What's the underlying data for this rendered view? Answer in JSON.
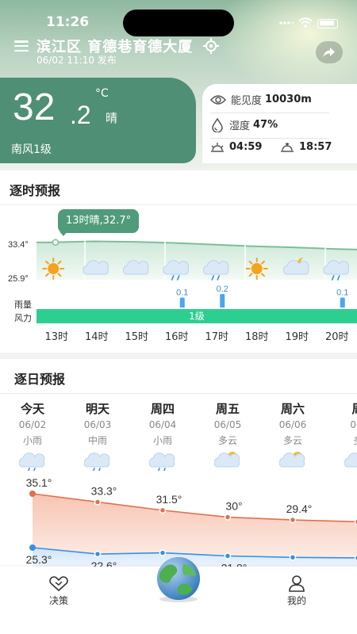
{
  "status_bar": {
    "time": "11:26"
  },
  "header": {
    "location": "滨江区 育德巷育德大厦",
    "publish_time": "06/02 11:10 发布"
  },
  "current": {
    "temp_int": "32",
    "temp_dec": ".2",
    "unit": "°C",
    "desc": "晴",
    "wind": "南风1级",
    "visibility_label": "能见度",
    "visibility_value": "10030m",
    "humidity_label": "湿度",
    "humidity_value": "47%",
    "sunrise": "04:59",
    "sunset": "18:57"
  },
  "hourly": {
    "title": "逐时预报",
    "tooltip": "13时晴,32.7°",
    "y_top": "33.4°",
    "y_bottom": "25.9°",
    "rain_label": "雨量",
    "wind_label": "风力",
    "wind_value": "1级",
    "hours": [
      "13时",
      "14时",
      "15时",
      "16时",
      "17时",
      "18时",
      "19时",
      "20时"
    ],
    "icons": [
      "sun-icon",
      "cloud-icon",
      "cloud-icon",
      "cloud-rain-icon",
      "cloud-rain-icon",
      "sun-icon",
      "cloud-moon-icon",
      "cloud-rain-icon"
    ],
    "rain_labels": [
      "",
      "",
      "",
      "0.1",
      "0.2",
      "",
      "",
      "0.1"
    ],
    "rain_values": [
      0,
      0,
      0,
      0.1,
      0.2,
      0,
      0,
      0.1
    ],
    "temps": [
      32.7,
      32.9,
      32.8,
      32.6,
      32.3,
      32.0,
      31.8,
      31.5
    ]
  },
  "daily": {
    "title": "逐日预报",
    "days": [
      {
        "name": "今天",
        "date": "06/02",
        "weather": "小雨",
        "icon": "cloud-rain-icon",
        "high": "35.1°",
        "low": "25.3°"
      },
      {
        "name": "明天",
        "date": "06/03",
        "weather": "中雨",
        "icon": "cloud-rain-icon",
        "high": "33.3°",
        "low": "22.6°"
      },
      {
        "name": "周四",
        "date": "06/04",
        "weather": "小雨",
        "icon": "cloud-rain-icon",
        "high": "31.5°",
        "low": ""
      },
      {
        "name": "周五",
        "date": "06/05",
        "weather": "多云",
        "icon": "cloud-sun-icon",
        "high": "30°",
        "low": "21.8°"
      },
      {
        "name": "周六",
        "date": "06/06",
        "weather": "多云",
        "icon": "cloud-sun-icon",
        "high": "29.4°",
        "low": ""
      },
      {
        "name": "周",
        "date": "06/",
        "weather": "多",
        "icon": "cloud-sun-icon",
        "high": "29",
        "low": ""
      }
    ],
    "highs": [
      35.1,
      33.3,
      31.5,
      30,
      29.4,
      29
    ],
    "lows": [
      25.3,
      22.6,
      23.1,
      21.8,
      21.2,
      21.0
    ]
  },
  "tabs": {
    "decision": "决策",
    "mine": "我的"
  },
  "colors": {
    "accent": "#4f8f75",
    "wind_bar": "#2dcf91",
    "high_line": "#e0704e",
    "low_line": "#3a8fe0"
  }
}
